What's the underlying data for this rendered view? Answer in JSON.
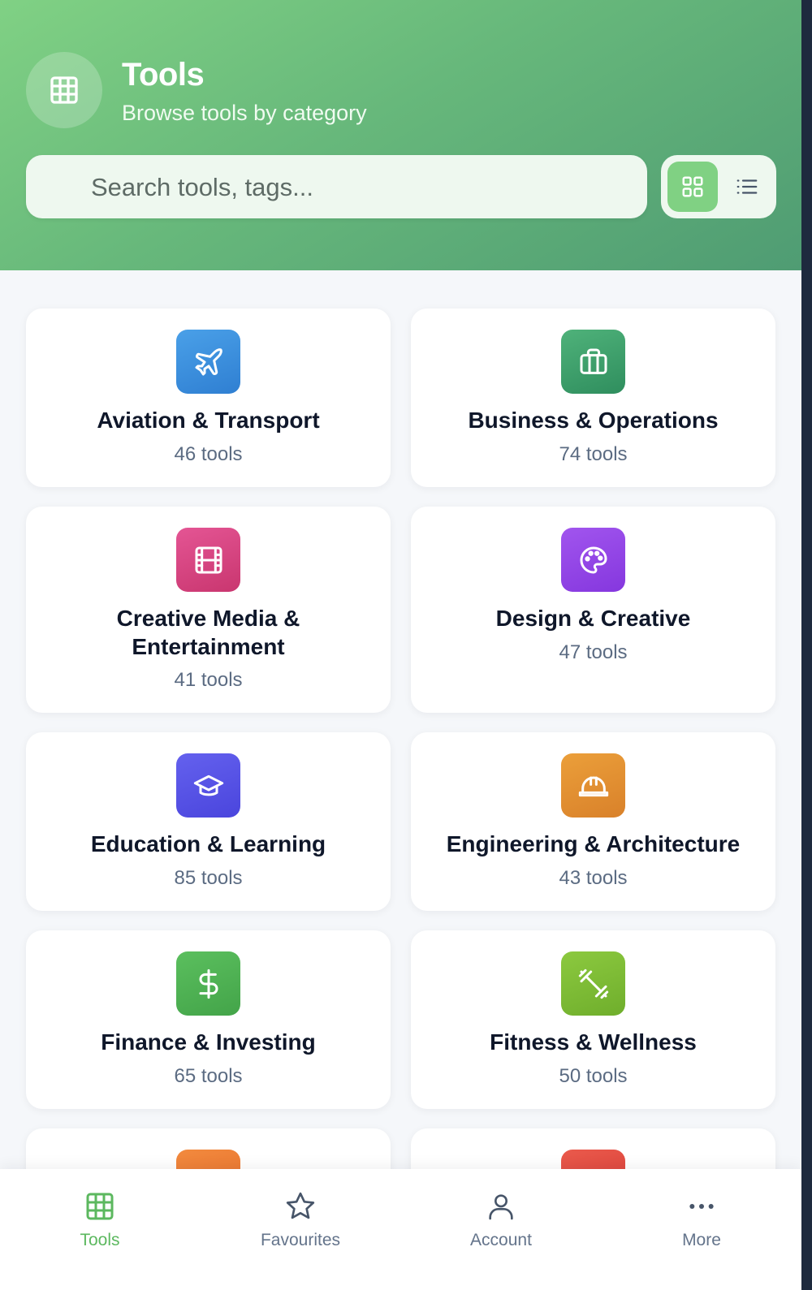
{
  "header": {
    "title": "Tools",
    "subtitle": "Browse tools by category",
    "logo_icon": "grid-table-icon",
    "gradient": [
      "#80d184",
      "#4f9c73"
    ]
  },
  "search": {
    "placeholder": "Search tools, tags...",
    "value": ""
  },
  "view_toggle": {
    "options": [
      "grid-view-icon",
      "list-view-icon"
    ],
    "selected": "grid",
    "accent": "#80d183"
  },
  "categories": [
    {
      "title": "Aviation & Transport",
      "count": "46 tools",
      "icon": "plane-icon",
      "color": "#3e91de"
    },
    {
      "title": "Business & Operations",
      "count": "74 tools",
      "icon": "briefcase-icon",
      "color": "#3f9f6c"
    },
    {
      "title": "Creative Media & Entertainment",
      "count": "41 tools",
      "icon": "film-icon",
      "color": "#db4683"
    },
    {
      "title": "Design & Creative",
      "count": "47 tools",
      "icon": "palette-icon",
      "color": "#9446e8"
    },
    {
      "title": "Education & Learning",
      "count": "85 tools",
      "icon": "graduation-cap-icon",
      "color": "#5551e6"
    },
    {
      "title": "Engineering & Architecture",
      "count": "43 tools",
      "icon": "hard-hat-icon",
      "color": "#e3922e"
    },
    {
      "title": "Finance & Investing",
      "count": "65 tools",
      "icon": "dollar-icon",
      "color": "#4fb556"
    },
    {
      "title": "Fitness & Wellness",
      "count": "50 tools",
      "icon": "dumbbell-icon",
      "color": "#7fbf35"
    },
    {
      "title": "",
      "count": "",
      "icon": "partial-icon",
      "color": "#ef7c33"
    },
    {
      "title": "",
      "count": "",
      "icon": "partial-icon",
      "color": "#e2473f"
    }
  ],
  "bottom_nav": {
    "items": [
      {
        "label": "Tools",
        "icon": "grid-table-icon",
        "active": true
      },
      {
        "label": "Favourites",
        "icon": "star-icon",
        "active": false
      },
      {
        "label": "Account",
        "icon": "user-icon",
        "active": false
      },
      {
        "label": "More",
        "icon": "more-dots-icon",
        "active": false
      }
    ],
    "active_color": "#5cb85f"
  }
}
